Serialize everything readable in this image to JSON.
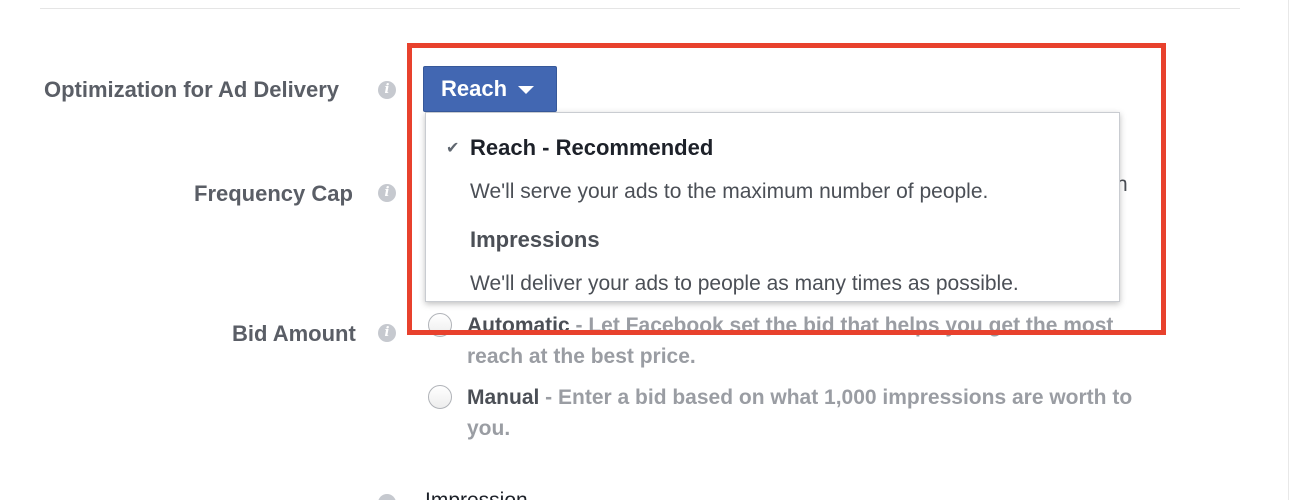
{
  "labels": {
    "optimization": "Optimization for Ad Delivery",
    "frequency_cap": "Frequency Cap",
    "bid_amount": "Bid Amount"
  },
  "info_icon_glyph": "i",
  "delivery_button": {
    "label": "Reach",
    "icon": "caret-down-icon"
  },
  "dropdown": {
    "check_glyph": "✔",
    "options": [
      {
        "title": "Reach - Recommended",
        "description": "We'll serve your ads to the maximum number of people.",
        "selected": true
      },
      {
        "title": "Impressions",
        "description": "We'll deliver your ads to people as many times as possible.",
        "selected": false
      }
    ]
  },
  "frequency_cap_fragment": "n",
  "bid": {
    "automatic_label": "Automatic",
    "automatic_desc_line1": " - Let Facebook set the bid that helps you get the most",
    "automatic_desc_line2": "reach at the best price.",
    "manual_label": "Manual",
    "manual_desc_line1": " - Enter a bid based on what 1,000 impressions are worth to",
    "manual_desc_line2": "you."
  },
  "bottom_fragment": "Impression",
  "colors": {
    "accent": "#4267b2",
    "highlight": "#e8412d"
  }
}
